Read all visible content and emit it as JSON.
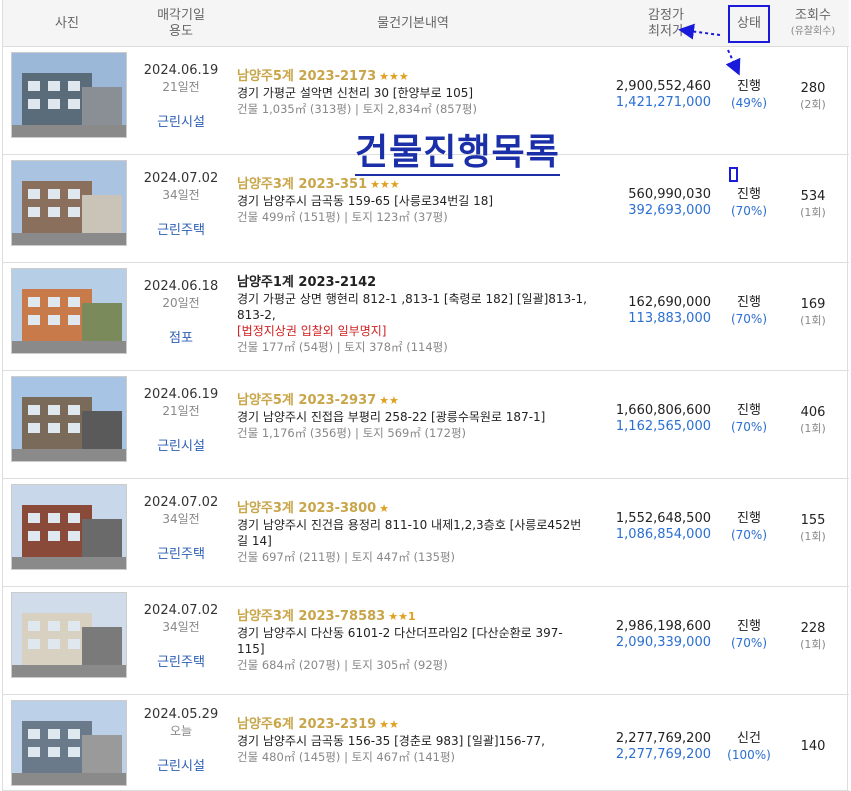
{
  "header": {
    "photo": "사진",
    "sale_date_line1": "매각기일",
    "sale_date_line2": "용도",
    "info": "물건기본내역",
    "price_line1": "감정가",
    "price_line2": "최저가",
    "status": "상태",
    "views_line1": "조회수",
    "views_line2": "(유찰회수)"
  },
  "overlay_title": "건물진행목록",
  "items": [
    {
      "date": "2024.06.19",
      "days": "21일전",
      "use": "근린시설",
      "case": "남양주5계 2023-2173",
      "stars": "★★★",
      "case_style": "gold",
      "addr": "경기 가평군 설악면 신천리 30 [한양부로 105]",
      "note": "",
      "area": "건물 1,035㎡ (313평)  |  토지 2,834㎡ (857평)",
      "appraisal": "2,900,552,460",
      "minimum": "1,421,271,000",
      "status": "진행",
      "pct": "(49%)",
      "views": "280",
      "sub": "(2회)"
    },
    {
      "date": "2024.07.02",
      "days": "34일전",
      "use": "근린주택",
      "case": "남양주3계 2023-351",
      "stars": "★★★",
      "case_style": "gold",
      "addr": "경기 남양주시 금곡동 159-65 [사릉로34번길 18]",
      "note": "",
      "area": "건물 499㎡ (151평)  |  토지 123㎡ (37평)",
      "appraisal": "560,990,030",
      "minimum": "392,693,000",
      "status": "진행",
      "pct": "(70%)",
      "views": "534",
      "sub": "(1회)"
    },
    {
      "date": "2024.06.18",
      "days": "20일전",
      "use": "점포",
      "case": "남양주1계 2023-2142",
      "stars": "",
      "case_style": "black",
      "addr": "경기 가평군 상면 행현리 812-1 ,813-1 [축령로 182] [일괄]813-1, 813-2,",
      "note": "[법정지상권  입찰외  일부명지]",
      "area": "건물 177㎡ (54평)  |  토지 378㎡ (114평)",
      "appraisal": "162,690,000",
      "minimum": "113,883,000",
      "status": "진행",
      "pct": "(70%)",
      "views": "169",
      "sub": "(1회)"
    },
    {
      "date": "2024.06.19",
      "days": "21일전",
      "use": "근린시설",
      "case": "남양주5계 2023-2937",
      "stars": "★★",
      "case_style": "gold",
      "addr": "경기 남양주시 진접읍 부평리 258-22 [광릉수목원로 187-1]",
      "note": "",
      "area": "건물 1,176㎡ (356평)  |  토지 569㎡ (172평)",
      "appraisal": "1,660,806,600",
      "minimum": "1,162,565,000",
      "status": "진행",
      "pct": "(70%)",
      "views": "406",
      "sub": "(1회)"
    },
    {
      "date": "2024.07.02",
      "days": "34일전",
      "use": "근린주택",
      "case": "남양주3계 2023-3800",
      "stars": "★",
      "case_style": "gold",
      "addr": "경기 남양주시 진건읍 용정리 811-10 내제1,2,3층호 [사릉로452번길 14]",
      "note": "",
      "area": "건물 697㎡ (211평)  |  토지 447㎡ (135평)",
      "appraisal": "1,552,648,500",
      "minimum": "1,086,854,000",
      "status": "진행",
      "pct": "(70%)",
      "views": "155",
      "sub": "(1회)"
    },
    {
      "date": "2024.07.02",
      "days": "34일전",
      "use": "근린주택",
      "case": "남양주3계 2023-78583",
      "stars": "★★1",
      "case_style": "gold",
      "addr": "경기 남양주시 다산동 6101-2 다산더프라임2 [다산순환로 397-115]",
      "note": "",
      "area": "건물 684㎡ (207평)  |  토지 305㎡ (92평)",
      "appraisal": "2,986,198,600",
      "minimum": "2,090,339,000",
      "status": "진행",
      "pct": "(70%)",
      "views": "228",
      "sub": "(1회)"
    },
    {
      "date": "2024.05.29",
      "days": "오늘",
      "use": "근린시설",
      "case": "남양주6계 2023-2319",
      "stars": "★★",
      "case_style": "gold",
      "addr": "경기 남양주시 금곡동 156-35 [경춘로 983]  [일괄]156-77,",
      "note": "",
      "area": "건물 480㎡ (145평)  |  토지 467㎡ (141평)",
      "appraisal": "2,277,769,200",
      "minimum": "2,277,769,200",
      "status": "신건",
      "pct": "(100%)",
      "views": "140",
      "sub": ""
    }
  ]
}
